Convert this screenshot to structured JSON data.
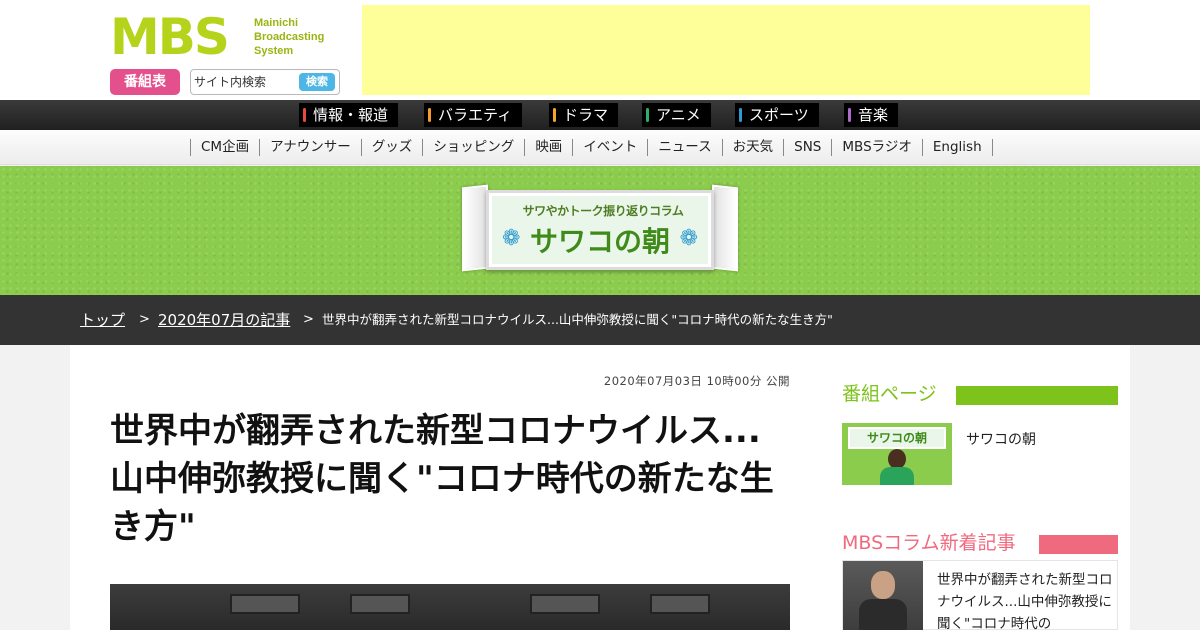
{
  "header": {
    "logo_mark": "MBS",
    "logo_sub_lines": [
      "Mainichi",
      "Broadcasting",
      "System"
    ],
    "program_guide_label": "番組表",
    "search_placeholder": "サイト内検索",
    "search_button": "検索"
  },
  "genre_nav": [
    {
      "label": "情報・報道",
      "color": "#e64b3c"
    },
    {
      "label": "バラエティ",
      "color": "#f39c2b"
    },
    {
      "label": "ドラマ",
      "color": "#f5a623"
    },
    {
      "label": "アニメ",
      "color": "#2eae6a"
    },
    {
      "label": "スポーツ",
      "color": "#2f9ad0"
    },
    {
      "label": "音楽",
      "color": "#b06ac9"
    }
  ],
  "sub_nav": [
    "CM企画",
    "アナウンサー",
    "グッズ",
    "ショッピング",
    "映画",
    "イベント",
    "ニュース",
    "お天気",
    "SNS",
    "MBSラジオ",
    "English"
  ],
  "banner": {
    "subtitle": "サワやかトーク振り返りコラム",
    "title": "サワコの朝",
    "flower": "❁"
  },
  "breadcrumb": {
    "top": "トップ",
    "separator": ">",
    "archive": "2020年07月の記事",
    "current": "世界中が翻弄された新型コロナウイルス...山中伸弥教授に聞く\"コロナ時代の新たな生き方\""
  },
  "article": {
    "published": "2020年07月03日 10時00分 公開",
    "title": "世界中が翻弄された新型コロナウイルス...山中伸弥教授に聞く\"コロナ時代の新たな生き方\""
  },
  "sidebar": {
    "program_heading": "番組ページ",
    "program_heading_color": "#7dc31b",
    "program_thumb_title": "サワコの朝",
    "program_name": "サワコの朝",
    "column_heading": "MBSコラム新着記事",
    "column_heading_color": "#f06a7f",
    "column_title": "世界中が翻弄された新型コロナウイルス...山中伸弥教授に聞く\"コロナ時代の"
  },
  "colors": {
    "brand_green": "#b5d31b",
    "program_guide_pink": "#e4508c",
    "search_blue": "#4cb6e6",
    "ad_yellow": "#ffff99",
    "banner_green": "#8ccc4d"
  }
}
